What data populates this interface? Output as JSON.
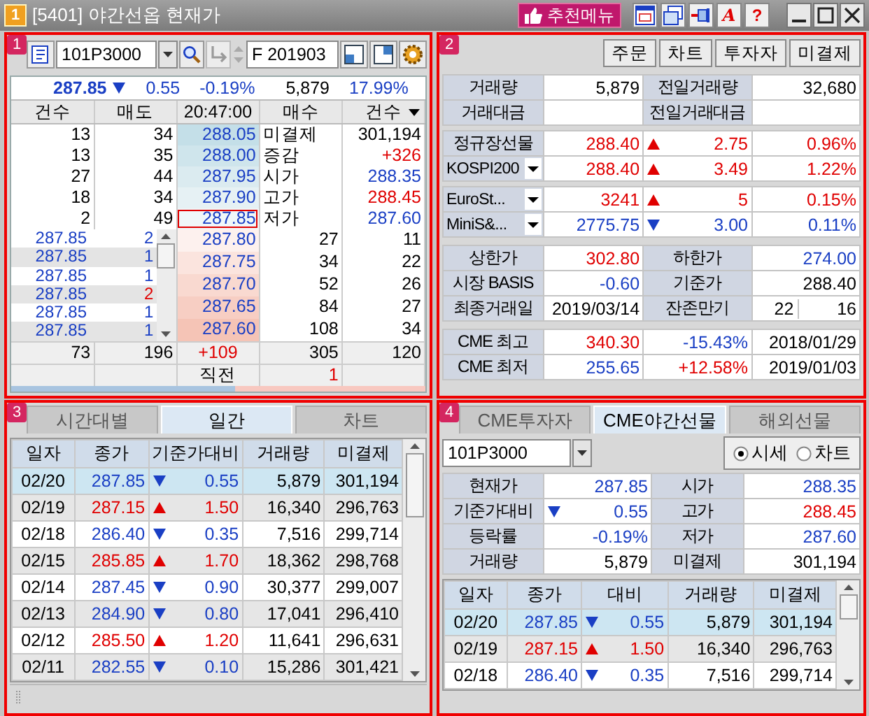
{
  "window": {
    "badge": "1",
    "title": "[5401] 야간선옵 현재가",
    "recommend_button": "추천메뉴",
    "font_button": "A",
    "help_button": "?"
  },
  "quote_panel": {
    "badge": "1",
    "code": "101P3000",
    "contract": "F 201903",
    "summary": {
      "price": {
        "text": "287.85",
        "color": "#1a3fc4"
      },
      "rising": false,
      "change": {
        "text": "0.55",
        "color": "#1a3fc4"
      },
      "rate": {
        "text": "-0.19%",
        "color": "#1a3fc4"
      },
      "volume": "5,879",
      "ratio": {
        "text": "17.99%",
        "color": "#1a3fc4"
      }
    },
    "columns": [
      "건수",
      "매도",
      "20:47:00",
      "매수",
      "건수"
    ],
    "asks": [
      {
        "count": "13",
        "qty": "34",
        "price": "288.05",
        "label": "미결제",
        "value": {
          "text": "301,194",
          "color": "#000000"
        },
        "current": false
      },
      {
        "count": "13",
        "qty": "35",
        "price": "288.00",
        "label": "증감",
        "value": {
          "text": "+326",
          "color": "#e00000"
        },
        "current": false
      },
      {
        "count": "27",
        "qty": "44",
        "price": "287.95",
        "label": "시가",
        "value": {
          "text": "288.35",
          "color": "#1a3fc4"
        },
        "current": false
      },
      {
        "count": "18",
        "qty": "34",
        "price": "287.90",
        "label": "고가",
        "value": {
          "text": "288.45",
          "color": "#e00000"
        },
        "current": false
      },
      {
        "count": "2",
        "qty": "49",
        "price": "287.85",
        "label": "저가",
        "value": {
          "text": "287.60",
          "color": "#1a3fc4"
        },
        "current": true
      }
    ],
    "ticks": [
      {
        "price": "287.85",
        "qty": "2",
        "color": "#1a3fc4"
      },
      {
        "price": "287.85",
        "qty": "1",
        "color": "#1a3fc4"
      },
      {
        "price": "287.85",
        "qty": "1",
        "color": "#1a3fc4"
      },
      {
        "price": "287.85",
        "qty": "2",
        "color": "#e00000"
      },
      {
        "price": "287.85",
        "qty": "1",
        "color": "#1a3fc4"
      },
      {
        "price": "287.85",
        "qty": "1",
        "color": "#1a3fc4"
      }
    ],
    "bids": [
      {
        "price": "287.80",
        "qty": "27",
        "count": "11"
      },
      {
        "price": "287.75",
        "qty": "34",
        "count": "22"
      },
      {
        "price": "287.70",
        "qty": "52",
        "count": "26"
      },
      {
        "price": "287.65",
        "qty": "84",
        "count": "27"
      },
      {
        "price": "287.60",
        "qty": "108",
        "count": "34"
      }
    ],
    "totals": [
      "73",
      "196",
      {
        "text": "+109",
        "color": "#e00000"
      },
      "305",
      "120"
    ],
    "previous": {
      "label": "직전",
      "value": {
        "text": "1",
        "color": "#e00000"
      }
    },
    "balance": {
      "level": 0.54
    }
  },
  "info_panel": {
    "badge": "2",
    "buttons": [
      "주문",
      "차트",
      "투자자",
      "미결제"
    ],
    "volume_rows": [
      {
        "label": "거래량",
        "value": "5,879",
        "label2": "전일거래량",
        "value2": "32,680"
      },
      {
        "label": "거래대금",
        "label2": "전일거래대금"
      }
    ],
    "index_groups": [
      [
        {
          "name": "정규장선물",
          "dropdown": false,
          "price": {
            "text": "288.40",
            "color": "#e00000"
          },
          "rising": true,
          "change": {
            "text": "2.75",
            "color": "#e00000"
          },
          "rate": {
            "text": "0.96%",
            "color": "#e00000"
          }
        },
        {
          "name": "KOSPI200",
          "dropdown": true,
          "price": {
            "text": "288.40",
            "color": "#e00000"
          },
          "rising": true,
          "change": {
            "text": "3.49",
            "color": "#e00000"
          },
          "rate": {
            "text": "1.22%",
            "color": "#e00000"
          }
        }
      ],
      [
        {
          "name": "EuroSt...",
          "dropdown": true,
          "price": {
            "text": "3241",
            "color": "#e00000"
          },
          "rising": true,
          "change": {
            "text": "5",
            "color": "#e00000"
          },
          "rate": {
            "text": "0.15%",
            "color": "#e00000"
          }
        },
        {
          "name": "MiniS&...",
          "dropdown": true,
          "price": {
            "text": "2775.75",
            "color": "#1a3fc4"
          },
          "rising": false,
          "change": {
            "text": "3.00",
            "color": "#1a3fc4"
          },
          "rate": {
            "text": "0.11%",
            "color": "#1a3fc4"
          }
        }
      ]
    ],
    "limit_rows": [
      {
        "label": "상한가",
        "value": {
          "text": "302.80",
          "color": "#e00000"
        },
        "label2": "하한가",
        "value2": {
          "text": "274.00",
          "color": "#1a3fc4"
        }
      },
      {
        "label": "시장 BASIS",
        "value": {
          "text": "-0.60",
          "color": "#1a3fc4"
        },
        "label2": "기준가",
        "value2": {
          "text": "288.40",
          "color": "#000000"
        }
      },
      {
        "label": "최종거래일",
        "value": {
          "text": "2019/03/14",
          "color": "#000000"
        },
        "label2": "잔존만기",
        "value2": {
          "text": "22",
          "color": "#000000"
        },
        "value3": "16"
      }
    ],
    "cme_rows": [
      {
        "label": "CME 최고",
        "price": {
          "text": "340.30",
          "color": "#e00000"
        },
        "rate": {
          "text": "-15.43%",
          "color": "#1a3fc4"
        },
        "date": "2018/01/29"
      },
      {
        "label": "CME 최저",
        "price": {
          "text": "255.65",
          "color": "#1a3fc4"
        },
        "rate": {
          "text": "+12.58%",
          "color": "#e00000"
        },
        "date": "2019/01/03"
      }
    ]
  },
  "daily_panel": {
    "badge": "3",
    "tabs": [
      {
        "label": "시간대별",
        "selected": false
      },
      {
        "label": "일간",
        "selected": true
      },
      {
        "label": "차트",
        "selected": false
      }
    ],
    "columns": [
      "일자",
      "종가",
      "기준가대비",
      "거래량",
      "미결제"
    ],
    "rows": [
      {
        "date": "02/20",
        "close": {
          "text": "287.85",
          "color": "#1a3fc4"
        },
        "rising": false,
        "change": {
          "text": "0.55",
          "color": "#1a3fc4"
        },
        "volume": "5,879",
        "open_interest": "301,194",
        "selected": true
      },
      {
        "date": "02/19",
        "close": {
          "text": "287.15",
          "color": "#e00000"
        },
        "rising": true,
        "change": {
          "text": "1.50",
          "color": "#e00000"
        },
        "volume": "16,340",
        "open_interest": "296,763",
        "selected": false
      },
      {
        "date": "02/18",
        "close": {
          "text": "286.40",
          "color": "#1a3fc4"
        },
        "rising": false,
        "change": {
          "text": "0.35",
          "color": "#1a3fc4"
        },
        "volume": "7,516",
        "open_interest": "299,714",
        "selected": false
      },
      {
        "date": "02/15",
        "close": {
          "text": "285.85",
          "color": "#e00000"
        },
        "rising": true,
        "change": {
          "text": "1.70",
          "color": "#e00000"
        },
        "volume": "18,362",
        "open_interest": "298,768",
        "selected": false
      },
      {
        "date": "02/14",
        "close": {
          "text": "287.45",
          "color": "#1a3fc4"
        },
        "rising": false,
        "change": {
          "text": "0.90",
          "color": "#1a3fc4"
        },
        "volume": "30,377",
        "open_interest": "299,007",
        "selected": false
      },
      {
        "date": "02/13",
        "close": {
          "text": "284.90",
          "color": "#1a3fc4"
        },
        "rising": false,
        "change": {
          "text": "0.80",
          "color": "#1a3fc4"
        },
        "volume": "17,041",
        "open_interest": "296,410",
        "selected": false
      },
      {
        "date": "02/12",
        "close": {
          "text": "285.50",
          "color": "#e00000"
        },
        "rising": true,
        "change": {
          "text": "1.20",
          "color": "#e00000"
        },
        "volume": "11,641",
        "open_interest": "296,631",
        "selected": false
      },
      {
        "date": "02/11",
        "close": {
          "text": "282.55",
          "color": "#1a3fc4"
        },
        "rising": false,
        "change": {
          "text": "0.10",
          "color": "#1a3fc4"
        },
        "volume": "15,286",
        "open_interest": "301,421",
        "selected": false
      }
    ]
  },
  "cme_panel": {
    "badge": "4",
    "tabs": [
      {
        "label": "CME투자자",
        "selected": false
      },
      {
        "label": "CME야간선물",
        "selected": true
      },
      {
        "label": "해외선물",
        "selected": false
      }
    ],
    "code": "101P3000",
    "view_options": [
      {
        "label": "시세",
        "selected": true
      },
      {
        "label": "차트",
        "selected": false
      }
    ],
    "stats": [
      {
        "label": "현재가",
        "value": {
          "text": "287.85",
          "color": "#1a3fc4"
        },
        "label2": "시가",
        "value2": {
          "text": "288.35",
          "color": "#1a3fc4"
        }
      },
      {
        "label": "기준가대비",
        "rising": false,
        "value": {
          "text": "0.55",
          "color": "#1a3fc4"
        },
        "label2": "고가",
        "value2": {
          "text": "288.45",
          "color": "#e00000"
        }
      },
      {
        "label": "등락률",
        "value": {
          "text": "-0.19%",
          "color": "#1a3fc4"
        },
        "label2": "저가",
        "value2": {
          "text": "287.60",
          "color": "#1a3fc4"
        }
      },
      {
        "label": "거래량",
        "value": {
          "text": "5,879",
          "color": "#000000"
        },
        "label2": "미결제",
        "value2": {
          "text": "301,194",
          "color": "#000000"
        }
      }
    ],
    "columns": [
      "일자",
      "종가",
      "대비",
      "거래량",
      "미결제"
    ],
    "rows": [
      {
        "date": "02/20",
        "close": {
          "text": "287.85",
          "color": "#1a3fc4"
        },
        "rising": false,
        "change": {
          "text": "0.55",
          "color": "#1a3fc4"
        },
        "volume": "5,879",
        "open_interest": "301,194",
        "selected": true
      },
      {
        "date": "02/19",
        "close": {
          "text": "287.15",
          "color": "#e00000"
        },
        "rising": true,
        "change": {
          "text": "1.50",
          "color": "#e00000"
        },
        "volume": "16,340",
        "open_interest": "296,763",
        "selected": false
      },
      {
        "date": "02/18",
        "close": {
          "text": "286.40",
          "color": "#1a3fc4"
        },
        "rising": false,
        "change": {
          "text": "0.35",
          "color": "#1a3fc4"
        },
        "volume": "7,516",
        "open_interest": "299,714",
        "selected": false
      }
    ]
  }
}
